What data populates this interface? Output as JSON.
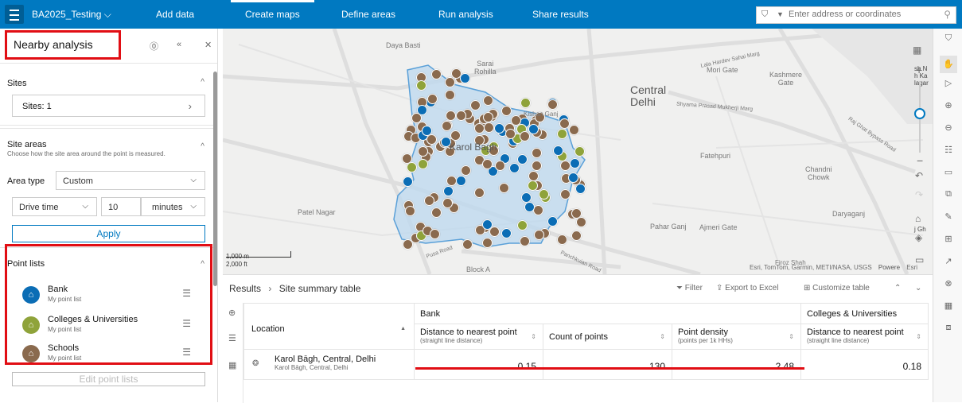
{
  "topbar": {
    "project": "BA2025_Testing",
    "nav": [
      "Add data",
      "Create maps",
      "Define areas",
      "Run analysis",
      "Share results"
    ],
    "search_placeholder": "Enter address or coordinates"
  },
  "panel": {
    "title": "Nearby analysis",
    "sites": {
      "label": "Sites",
      "button": "Sites: 1"
    },
    "site_areas": {
      "label": "Site areas",
      "description": "Choose how the site area around the point is measured.",
      "area_type_label": "Area type",
      "area_type_value": "Custom",
      "mode": "Drive time",
      "value": "10",
      "unit": "minutes",
      "apply": "Apply"
    },
    "point_lists": {
      "label": "Point lists",
      "items": [
        {
          "name": "Bank",
          "sub": "My point list",
          "color": "#0b6db5"
        },
        {
          "name": "Colleges & Universities",
          "sub": "My point list",
          "color": "#8fa33a"
        },
        {
          "name": "Schools",
          "sub": "My point list",
          "color": "#8a6a4e"
        }
      ],
      "edit": "Edit point lists"
    }
  },
  "map": {
    "labels": {
      "daya_basti": "Daya Basti",
      "sarai_rohilla": "Sarai\nRohilla",
      "kishan_ganj": "Kishan Ganj",
      "karol_bagh": "Karol Bagh",
      "central_delhi": "Central\nDelhi",
      "mori_gate": "Mori Gate",
      "kashmere_gate": "Kashmere\nGate",
      "fatehpuri": "Fatehpuri",
      "chandni_chowk": "Chandni\nChowk",
      "patel_nagar": "Patel Nagar",
      "pahar_ganj": "Pahar Ganj",
      "ajmeri_gate": "Ajmeri Gate",
      "daryaganj": "Daryaganj",
      "block_a": "Block A",
      "firoz_shah": "Firoz Shah",
      "road1": "Lala Hardev Sahai Marg",
      "road2": "Shyama Prasad Mukherji Marg",
      "road3": "Raj Ghat Bypass Road",
      "road4": "Pusa Road",
      "road5": "Panchkuian Road"
    },
    "scale": [
      "1,000 m",
      "2,000 ft"
    ],
    "attribution": "Esri, TomTom, Garmin, METI/NASA, USGS",
    "powered": "Powere",
    "edge_text": [
      "sh N",
      "h Ka",
      "lagar",
      "j Gh",
      "Esri"
    ]
  },
  "results": {
    "breadcrumb": [
      "Results",
      "Site summary table"
    ],
    "tools": {
      "filter": "Filter",
      "export": "Export to Excel",
      "customize": "Customize table"
    },
    "location_header": "Location",
    "groups": [
      "Bank",
      "Colleges & Universities"
    ],
    "columns": [
      {
        "name": "Distance to nearest point",
        "sub": "(straight line distance)"
      },
      {
        "name": "Count of points",
        "sub": ""
      },
      {
        "name": "Point density",
        "sub": "(points per 1k HHs)"
      },
      {
        "name": "Distance to nearest point",
        "sub": "(straight line distance)"
      }
    ],
    "rows": [
      {
        "name": "Karol Bāgh, Central, Delhi",
        "sub": "Karol Bāgh, Central, Delhi",
        "values": [
          "0.15",
          "130",
          "2.48",
          "0.18"
        ]
      }
    ]
  }
}
